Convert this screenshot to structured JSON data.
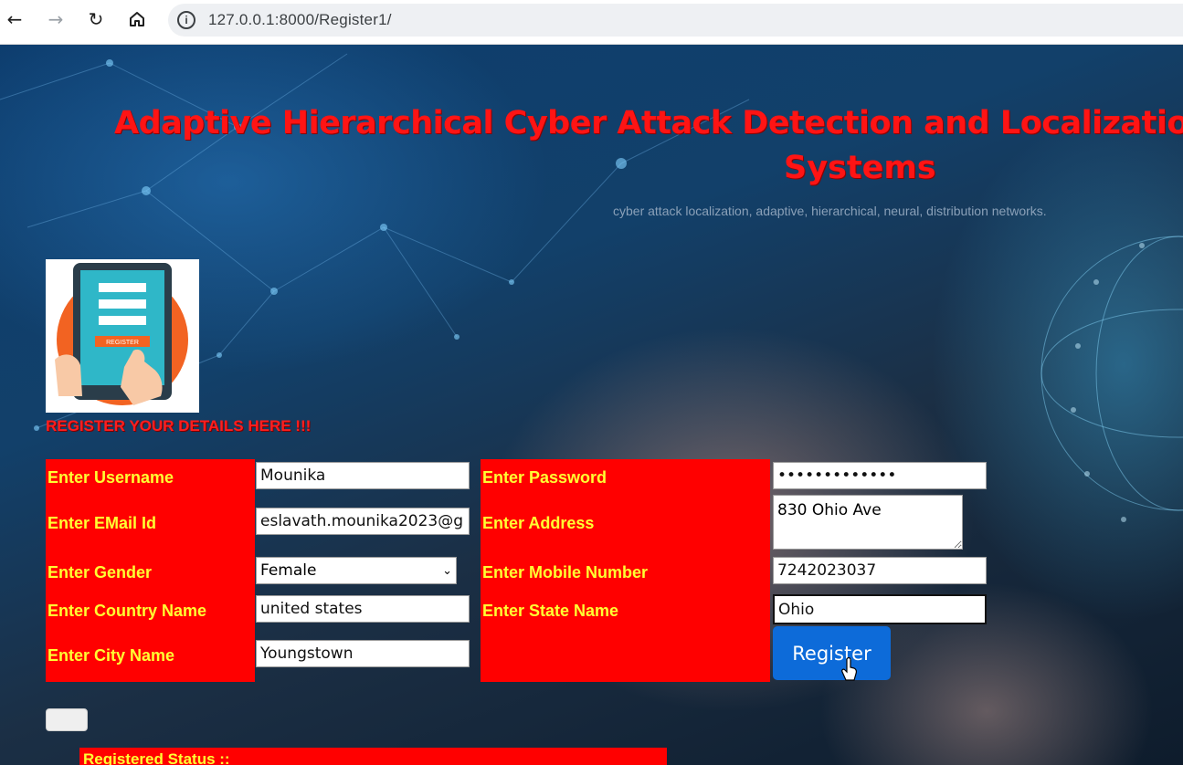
{
  "browser": {
    "url": "127.0.0.1:8000/Register1/",
    "back_icon": "arrow-left-icon",
    "forward_icon": "arrow-right-icon",
    "reload_icon": "reload-icon",
    "home_icon": "home-icon"
  },
  "header": {
    "title_line1": "Adaptive Hierarchical Cyber Attack Detection and Localizatio",
    "title_line2": "Systems",
    "subtitle": "cyber attack localization, adaptive, hierarchical, neural, distribution networks."
  },
  "logo": {
    "label": "REGISTER"
  },
  "form": {
    "heading": "REGISTER YOUR DETAILS HERE !!!",
    "username": {
      "label": "Enter Username",
      "value": "Mounika"
    },
    "email": {
      "label": "Enter EMail Id",
      "value": "eslavath.mounika2023@g"
    },
    "gender": {
      "label": "Enter Gender",
      "value": "Female"
    },
    "country": {
      "label": "Enter Country Name",
      "value": "united states"
    },
    "city": {
      "label": "Enter City Name",
      "value": "Youngstown"
    },
    "password": {
      "label": "Enter Password",
      "value": "•••••••••••••"
    },
    "address": {
      "label": "Enter Address",
      "value": "830 Ohio Ave"
    },
    "mobile": {
      "label": "Enter Mobile Number",
      "value": "7242023037"
    },
    "state": {
      "label": "Enter State Name",
      "value": "Ohio"
    },
    "submit_label": "Register"
  },
  "status": {
    "label": "Registered Status ::"
  },
  "colors": {
    "label_bg": "#ff0000",
    "label_text": "#ffff33",
    "title": "#ff1414",
    "button": "#0d6bd9"
  }
}
